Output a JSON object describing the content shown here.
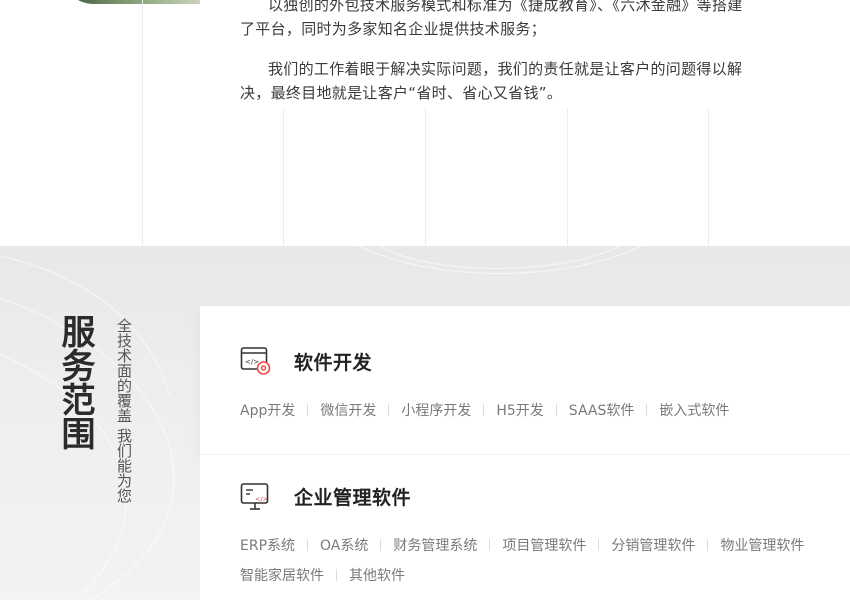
{
  "intro": {
    "paragraph_1_line_1": "以独创的外包技术服务模式和标准为《捷成教育》、《六沐金融》等搭建",
    "paragraph_1_line_2": "了平台，同时为多家知名企业提供技术服务；",
    "paragraph_2_line_1": "我们的工作着眼于解决实际问题，我们的责任就是让客户的问题得以解",
    "paragraph_2_line_2": "决，最终目地就是让客户“省时、省心又省钱”。"
  },
  "services": {
    "title": "服务范围",
    "subtitle": "全技术面的覆盖 我们能为您",
    "cards": [
      {
        "icon": "code-gear-icon",
        "title": "软件开发",
        "tags": [
          "App开发",
          "微信开发",
          "小程序开发",
          "H5开发",
          "SAAS软件",
          "嵌入式软件"
        ]
      },
      {
        "icon": "monitor-code-icon",
        "title": "企业管理软件",
        "tags_row_1": [
          "ERP系统",
          "OA系统",
          "财务管理系统",
          "项目管理软件",
          "分销管理软件",
          "物业管理软件"
        ],
        "tags_row_2": [
          "智能家居软件",
          "其他软件"
        ]
      }
    ]
  },
  "colors": {
    "accent_red": "#e84a4a",
    "text_dark": "#222222",
    "text_muted": "#7a7a7a",
    "section_bg": "#eceef0"
  }
}
